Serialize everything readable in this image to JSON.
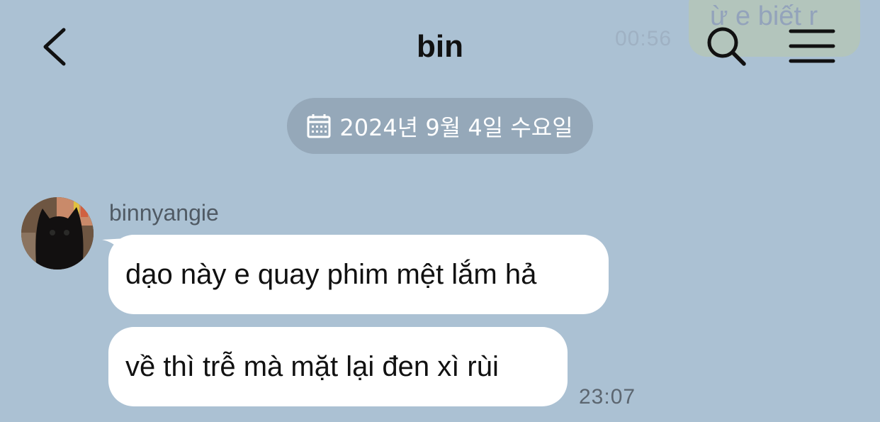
{
  "background_color": "#abc1d3",
  "header": {
    "title": "bin",
    "back_icon": "chevron-left-icon",
    "search_icon": "search-icon",
    "menu_icon": "hamburger-menu-icon"
  },
  "previous_message": {
    "text": "ừ e biết r",
    "time": "00:56"
  },
  "date_divider": {
    "icon": "calendar-icon",
    "label": "2024년 9월 4일 수요일"
  },
  "conversation": {
    "sender": "binnyangie",
    "messages": [
      {
        "text": "dạo này e quay phim mệt lắm hả"
      },
      {
        "text": "về thì trễ mà mặt lại đen xì rùi"
      }
    ],
    "time": "23:07"
  }
}
